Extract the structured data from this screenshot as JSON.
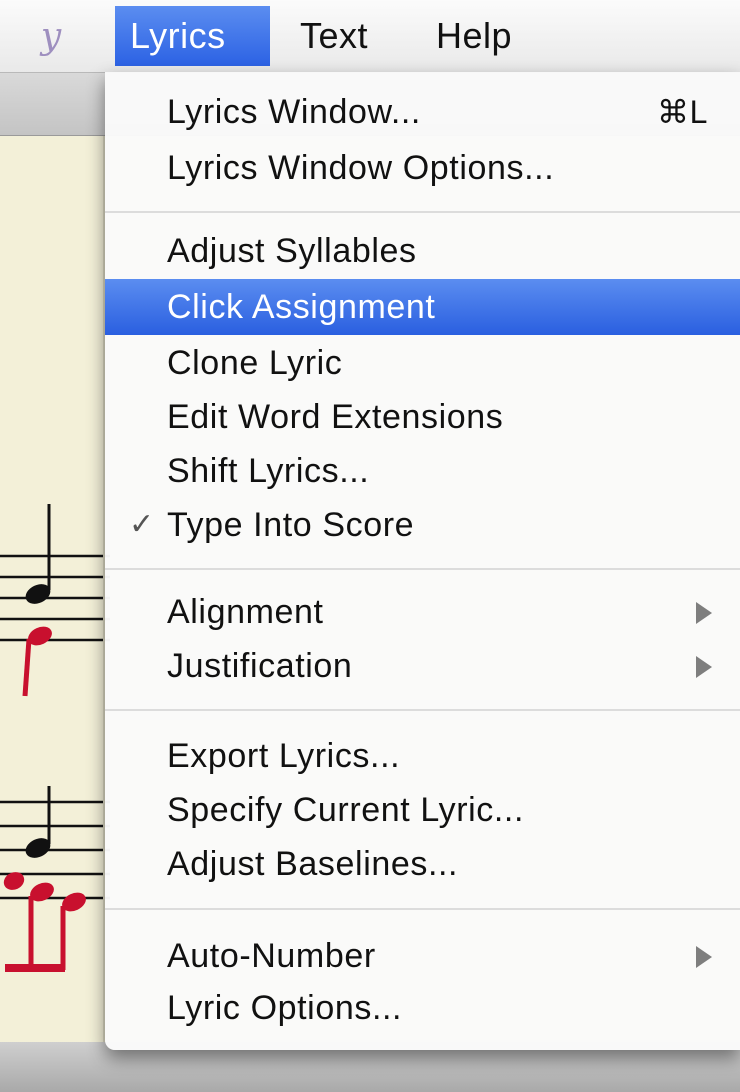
{
  "menubar": {
    "app_icon": "score-app-icon",
    "menus": [
      "Lyrics",
      "Text",
      "Help"
    ]
  },
  "dropdown": {
    "highlight_color": "#3d72e8",
    "groups": [
      [
        {
          "label": "Lyrics Window...",
          "shortcut": "⌘L"
        },
        {
          "label": "Lyrics Window Options..."
        }
      ],
      [
        {
          "label": "Adjust Syllables"
        },
        {
          "label": "Click Assignment",
          "highlighted": true
        },
        {
          "label": "Clone Lyric"
        },
        {
          "label": "Edit Word Extensions"
        },
        {
          "label": "Shift Lyrics..."
        },
        {
          "label": "Type Into Score",
          "checked": true,
          "check_mark": "✓"
        }
      ],
      [
        {
          "label": "Alignment",
          "submenu": true
        },
        {
          "label": "Justification",
          "submenu": true
        }
      ],
      [
        {
          "label": "Export Lyrics..."
        },
        {
          "label": "Specify Current Lyric..."
        },
        {
          "label": "Adjust Baselines..."
        }
      ],
      [
        {
          "label": "Auto-Number",
          "submenu": true
        },
        {
          "label": "Lyric Options..."
        }
      ]
    ]
  },
  "score": {
    "note_color_black": "#111111",
    "note_color_red": "#c8102e"
  }
}
